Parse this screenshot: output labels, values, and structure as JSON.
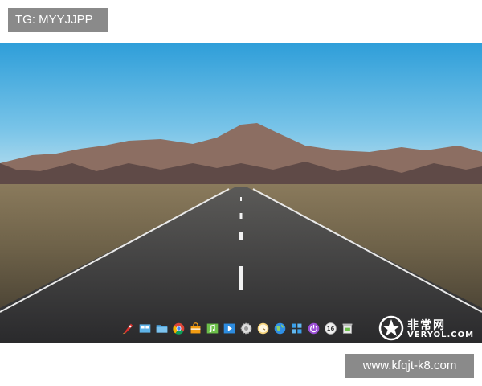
{
  "watermarks": {
    "top_left": "TG: MYYJJPP",
    "bottom_right": "www.kfqjt-k8.com",
    "logo_cn": "非常网",
    "logo_en": "VERYOL.COM"
  },
  "dock": {
    "items": [
      {
        "icon": "rocket-launcher-icon",
        "color": "#d9302c"
      },
      {
        "icon": "multitask-view-icon",
        "color": "#5fb3e8"
      },
      {
        "icon": "file-manager-icon",
        "color": "#4aa3df"
      },
      {
        "icon": "chrome-browser-icon",
        "color": "#db4437"
      },
      {
        "icon": "app-store-icon",
        "color": "#f39c12"
      },
      {
        "icon": "music-player-icon",
        "color": "#6cc04a"
      },
      {
        "icon": "video-player-icon",
        "color": "#2d8ce0"
      },
      {
        "icon": "settings-gear-icon",
        "color": "#e0e0e0"
      },
      {
        "icon": "clock-icon",
        "color": "#f5d37a"
      },
      {
        "icon": "globe-browser-icon",
        "color": "#2f8fe6"
      },
      {
        "icon": "puzzle-app-icon",
        "color": "#3aa0ea"
      },
      {
        "icon": "power-button-icon",
        "color": "#9b4fd6"
      },
      {
        "icon": "calendar-icon",
        "color": "#f0f0f0",
        "label": "16"
      },
      {
        "icon": "trash-icon",
        "color": "#e8e8e8"
      }
    ]
  }
}
